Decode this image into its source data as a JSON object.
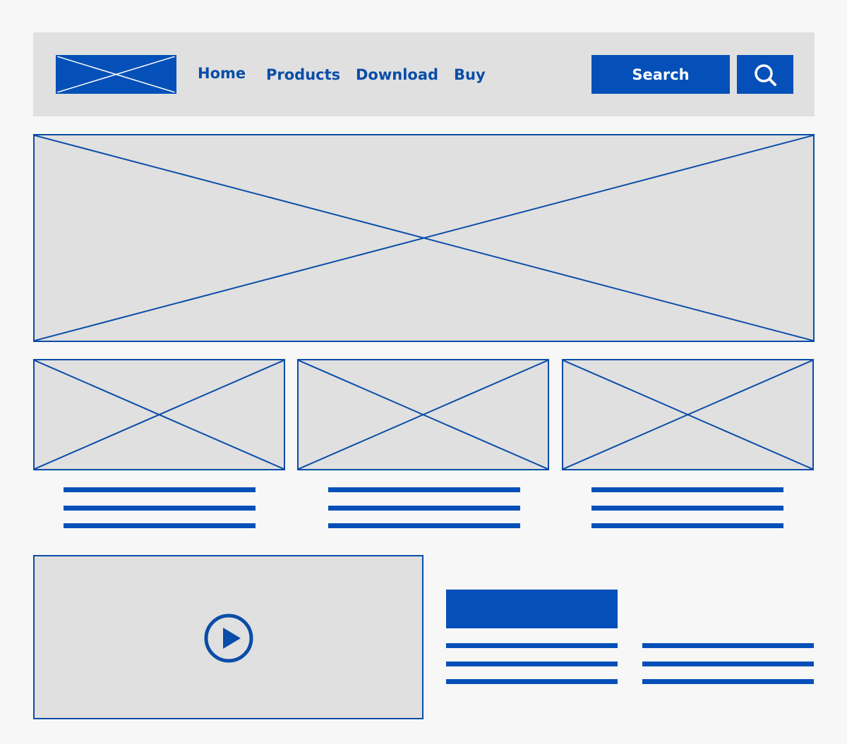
{
  "colors": {
    "accent": "#0550b8",
    "placeholder_fill": "#e0e0e0",
    "background": "#f7f7f7"
  },
  "header": {
    "logo": "image-placeholder",
    "nav": [
      {
        "label": "Home"
      },
      {
        "label": "Products"
      },
      {
        "label": "Download"
      },
      {
        "label": "Buy"
      }
    ],
    "search_label": "Search",
    "search_icon": "magnifier-icon"
  },
  "video": {
    "icon": "play-icon"
  }
}
